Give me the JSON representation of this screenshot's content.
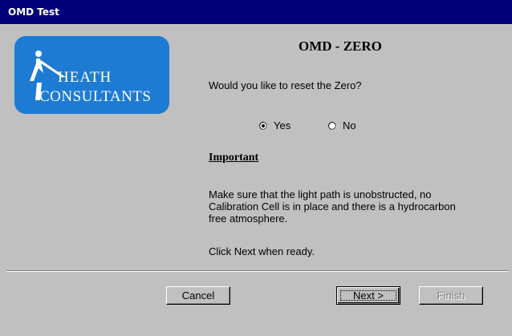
{
  "window": {
    "title": "OMD Test"
  },
  "logo": {
    "text_line1": "HEATH",
    "text_line2": "CONSULTANTS",
    "background_color": "#1e7bd3"
  },
  "dialog": {
    "title": "OMD - ZERO",
    "question": "Would you like to reset the Zero?",
    "options": [
      {
        "label": "Yes",
        "selected": true
      },
      {
        "label": "No",
        "selected": false
      }
    ],
    "important_heading": "Important",
    "instructions": "Make sure that the light path is unobstructed, no Calibration Cell is in place and there is a hydrocarbon free atmosphere.",
    "ready_text": "Click Next when ready."
  },
  "buttons": {
    "cancel": "Cancel",
    "next": "Next >",
    "finish": "Finish"
  },
  "colors": {
    "titlebar": "#000078",
    "dialog_face": "#c0c0c0"
  }
}
